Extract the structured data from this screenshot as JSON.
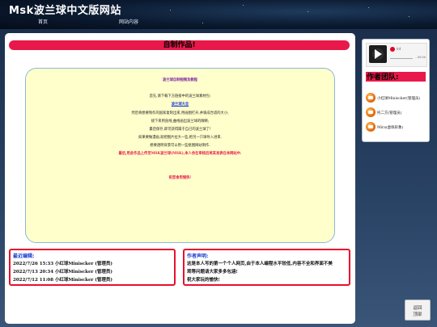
{
  "header": {
    "site_title": "Msk波兰球中文版网站",
    "nav": [
      "首页",
      "网站内容"
    ]
  },
  "main": {
    "page_title": "自制作品!",
    "card": {
      "heading": "波兰球自制视频及教程",
      "lines": [
        "首先,请下载下方链接中的波兰球素材包:",
        "波兰球大全",
        "然后将想要制作的国家复制出来,用画图打开,并调成合适的大小;",
        "接下来用直线,曲线画出波兰球的眼睛;",
        "最后保存,即可获得属于自己的波兰球了!",
        "如果要做漫画,就把图片拉大一些,把另一只球导入进来.",
        "想要透明背景可以用一些抠图网站制作.",
        "最后,用此作品上传至MSK波兰球(MSK),本人会在审核后将其发表在本网站中."
      ],
      "closing": "祝您食用愉快!"
    },
    "recent_edits": {
      "heading": "最近编辑:",
      "entries": [
        "2022/7/26 15:33 小红球Miniscker (管理员)",
        "2022/7/13 20:34 小红球Miniscker (管理员)",
        "2022/7/12 11:08 小红球Miniscker (管理员)"
      ]
    },
    "author_note": {
      "heading": "作者声明:",
      "lines": [
        "这是本人写的第一个个人网页,由于本人编程水平较低,内容不全和界面不美",
        "观等问题请大家多多包涵!",
        "祝大家玩的愉快!"
      ]
    }
  },
  "sidebar": {
    "player": {
      "brand_icon": "netease-music-icon",
      "track": "int",
      "time": "- 00:00"
    },
    "team_title": "作者团队:",
    "members": [
      {
        "name": "小红球Miniscker(管理员)"
      },
      {
        "name": "托二方(管理员)"
      },
      {
        "name": "Mira(虚拟形象)"
      }
    ]
  },
  "back_to_top": [
    "返回",
    "顶部"
  ],
  "colors": {
    "accent_red": "#e8194a",
    "card_bg": "#ffffcc",
    "link_blue": "#1a3fd0",
    "heading_purple": "#7a1fa2"
  }
}
